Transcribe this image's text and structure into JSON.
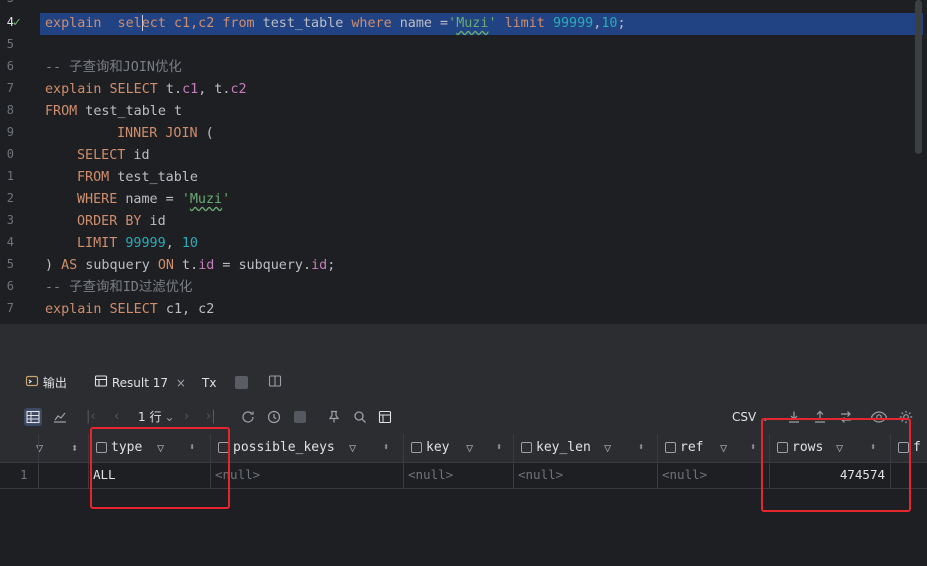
{
  "editor": {
    "line_numbers": [
      "3",
      "4",
      "5",
      "6",
      "7",
      "8",
      "9",
      "0",
      "1",
      "2",
      "3",
      "4",
      "5",
      "6",
      "7"
    ],
    "line1": {
      "p1": "explain  sel",
      "p2": "ect c1,c2 ",
      "p3": "from",
      "p4": " test_table ",
      "p5": "where",
      "p6": " name =",
      "p7": "'",
      "p8": "Muzi",
      "p9": "' ",
      "p10": "limit",
      "p11": " ",
      "p12": "99999",
      "p13": ",",
      "p14": "10",
      "p15": ";"
    },
    "comment1": "-- 子查询和JOIN优化",
    "line3": {
      "p1": "explain SELECT",
      "p2": " t.",
      "p3": "c1",
      "p4": ", t.",
      "p5": "c2"
    },
    "line4": {
      "p1": "FROM",
      "p2": " test_table t"
    },
    "line5": {
      "p1": "INNER JOIN",
      "p2": " ("
    },
    "line6": {
      "p1": "SELECT",
      "p2": " id"
    },
    "line7": {
      "p1": "FROM",
      "p2": " test_table"
    },
    "line8": {
      "p1": "WHERE",
      "p2": " name = ",
      "p3": "'",
      "p4": "Muzi",
      "p5": "'"
    },
    "line9": {
      "p1": "ORDER BY",
      "p2": " id"
    },
    "line10": {
      "p1": "LIMIT",
      "p2": " ",
      "p3": "99999",
      "p4": ", ",
      "p5": "10"
    },
    "line11": {
      "p1": ") ",
      "p2": "AS",
      "p3": " subquery ",
      "p4": "ON",
      "p5": " t.",
      "p6": "id",
      "p7": " = subquery.",
      "p8": "id",
      "p9": ";"
    },
    "comment2": "-- 子查询和ID过滤优化",
    "line13": {
      "p1": "explain SELECT",
      "p2": " c1, c2"
    }
  },
  "tabs": {
    "output_label": "输出",
    "result_label": "Result 17",
    "close_glyph": "×",
    "tx_label": "Tx"
  },
  "toolbar": {
    "page_label": "1 行",
    "export_format": "CSV"
  },
  "grid": {
    "columns": [
      "type",
      "possible_keys",
      "key",
      "key_len",
      "ref",
      "rows",
      "f"
    ],
    "row": {
      "index": "1",
      "type": "ALL",
      "possible_keys": "<null>",
      "key": "<null>",
      "key_len": "<null>",
      "ref": "<null>",
      "rows": "474574"
    }
  },
  "colors": {
    "accent_red": "#e5262e",
    "selection": "#214283",
    "keyword": "#cf8e6d",
    "number": "#2aacb8",
    "string": "#6aab73"
  }
}
